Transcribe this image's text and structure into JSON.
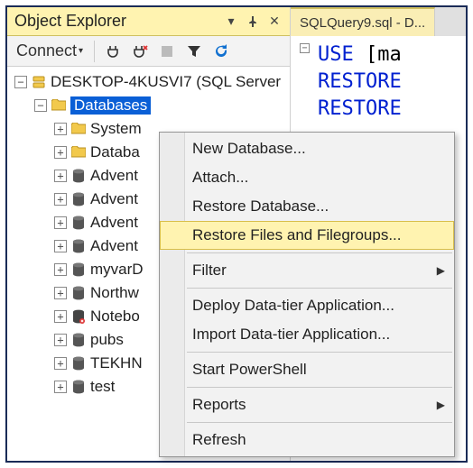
{
  "panel": {
    "title": "Object Explorer",
    "toolbar": {
      "connect_label": "Connect"
    }
  },
  "tree": {
    "server": {
      "label": "DESKTOP-4KUSVI7 (SQL Server",
      "expanded": true
    },
    "databases": {
      "label": "Databases",
      "expanded": true,
      "selected": true
    },
    "items": [
      {
        "label": "System",
        "icon": "folder"
      },
      {
        "label": "Databa",
        "icon": "folder"
      },
      {
        "label": "Advent",
        "icon": "db"
      },
      {
        "label": "Advent",
        "icon": "db"
      },
      {
        "label": "Advent",
        "icon": "db"
      },
      {
        "label": "Advent",
        "icon": "db"
      },
      {
        "label": "myvarD",
        "icon": "db"
      },
      {
        "label": "Northw",
        "icon": "db"
      },
      {
        "label": "Notebo",
        "icon": "db-err"
      },
      {
        "label": "pubs",
        "icon": "db"
      },
      {
        "label": "TEKHN",
        "icon": "db"
      },
      {
        "label": "test",
        "icon": "db"
      }
    ]
  },
  "context_menu": {
    "items": [
      {
        "label": "New Database...",
        "type": "item"
      },
      {
        "label": "Attach...",
        "type": "item"
      },
      {
        "label": "Restore Database...",
        "type": "item"
      },
      {
        "label": "Restore Files and Filegroups...",
        "type": "item",
        "highlight": true
      },
      {
        "type": "sep"
      },
      {
        "label": "Filter",
        "type": "item",
        "submenu": true
      },
      {
        "type": "sep"
      },
      {
        "label": "Deploy Data-tier Application...",
        "type": "item"
      },
      {
        "label": "Import Data-tier Application...",
        "type": "item"
      },
      {
        "type": "sep"
      },
      {
        "label": "Start PowerShell",
        "type": "item"
      },
      {
        "type": "sep"
      },
      {
        "label": "Reports",
        "type": "item",
        "submenu": true
      },
      {
        "type": "sep"
      },
      {
        "label": "Refresh",
        "type": "item"
      }
    ]
  },
  "editor": {
    "tab_label": "SQLQuery9.sql - D...",
    "lines": [
      {
        "kw": "USE",
        "rest": " [ma"
      },
      {
        "kw": "RESTORE",
        "rest": ""
      },
      {
        "kw": "RESTORE",
        "rest": ""
      }
    ]
  }
}
